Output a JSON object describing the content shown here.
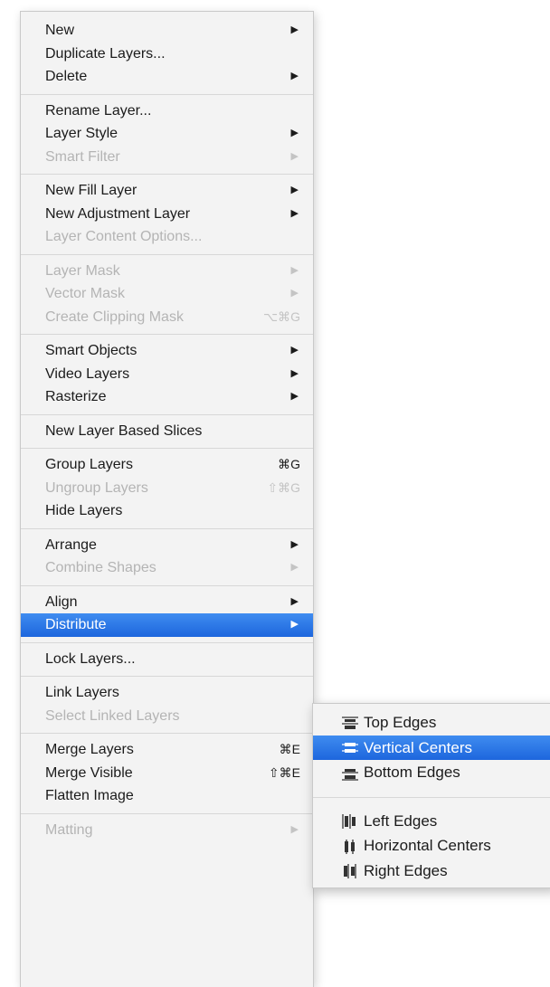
{
  "menu": {
    "groups": [
      {
        "items": [
          {
            "label": "New",
            "arrow": "▶"
          },
          {
            "label": "Duplicate Layers..."
          },
          {
            "label": "Delete",
            "arrow": "▶"
          }
        ]
      },
      {
        "items": [
          {
            "label": "Rename Layer..."
          },
          {
            "label": "Layer Style",
            "arrow": "▶"
          },
          {
            "label": "Smart Filter",
            "arrow": "▶",
            "disabled": true
          }
        ]
      },
      {
        "items": [
          {
            "label": "New Fill Layer",
            "arrow": "▶"
          },
          {
            "label": "New Adjustment Layer",
            "arrow": "▶"
          },
          {
            "label": "Layer Content Options...",
            "disabled": true
          }
        ]
      },
      {
        "items": [
          {
            "label": "Layer Mask",
            "arrow": "▶",
            "disabled": true
          },
          {
            "label": "Vector Mask",
            "arrow": "▶",
            "disabled": true
          },
          {
            "label": "Create Clipping Mask",
            "shortcut": "⌥⌘G",
            "disabled": true
          }
        ]
      },
      {
        "items": [
          {
            "label": "Smart Objects",
            "arrow": "▶"
          },
          {
            "label": "Video Layers",
            "arrow": "▶"
          },
          {
            "label": "Rasterize",
            "arrow": "▶"
          }
        ]
      },
      {
        "items": [
          {
            "label": "New Layer Based Slices"
          }
        ]
      },
      {
        "items": [
          {
            "label": "Group Layers",
            "shortcut": "⌘G"
          },
          {
            "label": "Ungroup Layers",
            "shortcut": "⇧⌘G",
            "disabled": true
          },
          {
            "label": "Hide Layers"
          }
        ]
      },
      {
        "items": [
          {
            "label": "Arrange",
            "arrow": "▶"
          },
          {
            "label": "Combine Shapes",
            "arrow": "▶",
            "disabled": true
          }
        ]
      },
      {
        "items": [
          {
            "label": "Align",
            "arrow": "▶"
          },
          {
            "label": "Distribute",
            "arrow": "▶",
            "highlight": true
          }
        ]
      },
      {
        "items": [
          {
            "label": "Lock Layers..."
          }
        ]
      },
      {
        "items": [
          {
            "label": "Link Layers"
          },
          {
            "label": "Select Linked Layers",
            "disabled": true
          }
        ]
      },
      {
        "items": [
          {
            "label": "Merge Layers",
            "shortcut": "⌘E"
          },
          {
            "label": "Merge Visible",
            "shortcut": "⇧⌘E"
          },
          {
            "label": "Flatten Image"
          }
        ]
      },
      {
        "items": [
          {
            "label": "Matting",
            "arrow": "▶",
            "disabled": true
          }
        ]
      }
    ]
  },
  "submenu": {
    "groups": [
      {
        "items": [
          {
            "label": "Top Edges",
            "icon": "distribute-top-edges-icon"
          },
          {
            "label": "Vertical Centers",
            "icon": "distribute-vertical-centers-icon",
            "highlight": true
          },
          {
            "label": "Bottom Edges",
            "icon": "distribute-bottom-edges-icon"
          }
        ]
      },
      {
        "items": [
          {
            "label": "Left Edges",
            "icon": "distribute-left-edges-icon"
          },
          {
            "label": "Horizontal Centers",
            "icon": "distribute-horizontal-centers-icon"
          },
          {
            "label": "Right Edges",
            "icon": "distribute-right-edges-icon"
          }
        ]
      }
    ]
  },
  "colors": {
    "menu_bg": "#f3f3f3",
    "highlight": "#2a75e6",
    "disabled_text": "#b4b4b4",
    "text": "#1b1b1b"
  }
}
